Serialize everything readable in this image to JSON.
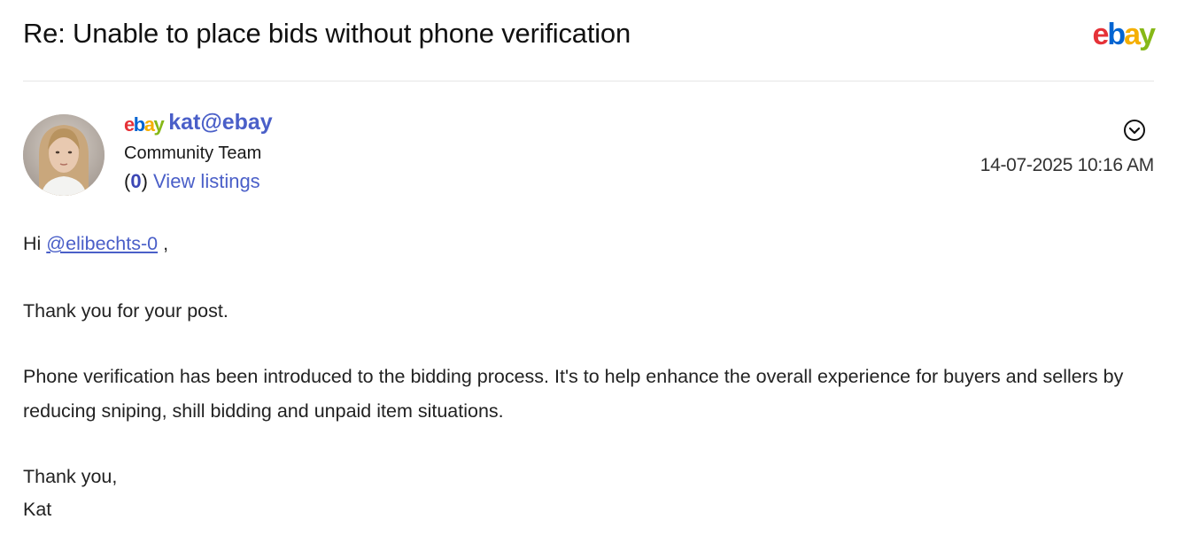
{
  "post": {
    "title": "Re: Unable to place bids without phone verification",
    "brand_logo": {
      "letters": [
        "e",
        "b",
        "a",
        "y"
      ],
      "colors": {
        "e": "#e53238",
        "b": "#0064d2",
        "a": "#f5af02",
        "y": "#86b817"
      }
    },
    "author": {
      "name": "kat@ebay",
      "role": "Community Team",
      "listings_open": "(",
      "listings_count": "0",
      "listings_close": ")",
      "listings_link": "View listings",
      "name_color": "#4a5fc8"
    },
    "menu_icon": "chevron-down-circle-icon",
    "timestamp": "14-07-2025 10:16 AM",
    "body": {
      "greeting_prefix": "Hi ",
      "mention": "@elibechts-0",
      "greeting_suffix": " ,",
      "line1": "Thank you for your post.",
      "paragraph": "Phone verification has been introduced to the bidding process.  It's to help enhance the overall experience for buyers and sellers by reducing sniping, shill bidding and unpaid item situations.",
      "signoff": "Thank you,",
      "signature": "Kat"
    }
  }
}
